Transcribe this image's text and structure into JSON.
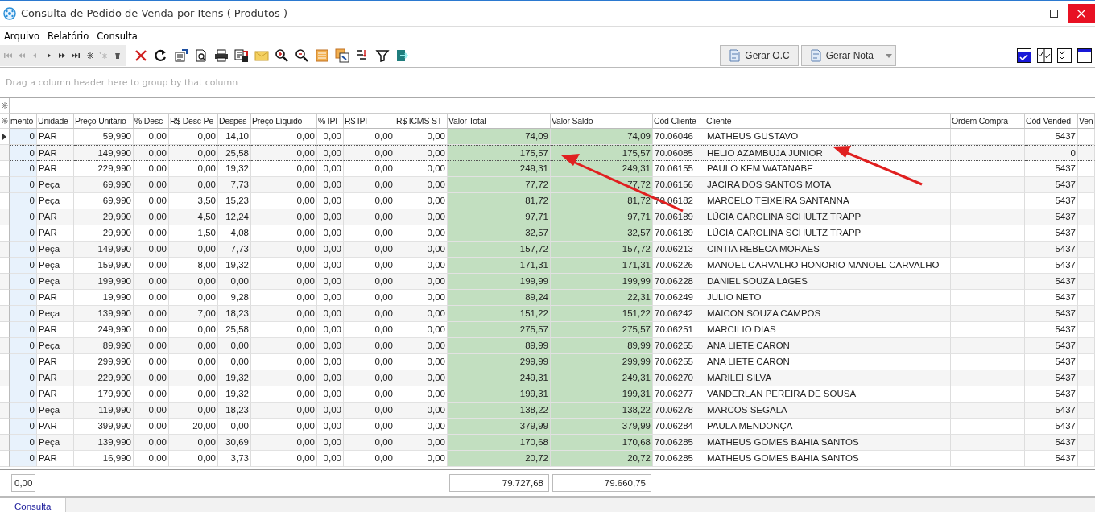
{
  "window": {
    "title": "Consulta de Pedido de Venda por Itens ( Produtos )"
  },
  "menu": [
    {
      "label": "Arquivo"
    },
    {
      "label": "Relatório"
    },
    {
      "label": "Consulta"
    }
  ],
  "toolbar": {
    "buttons": [
      {
        "label": "Gerar O.C",
        "dropdown": false
      },
      {
        "label": "Gerar Nota",
        "dropdown": true
      }
    ]
  },
  "group_panel": {
    "hint": "Drag a column header here to group by that column"
  },
  "table": {
    "columns": [
      {
        "label": "mento",
        "kind": "key",
        "summary": "0,00"
      },
      {
        "label": "Unidade",
        "kind": "text"
      },
      {
        "label": "Preço Unitário",
        "kind": "number"
      },
      {
        "label": "% Desc",
        "kind": "number"
      },
      {
        "label": "R$ Desc Pe",
        "kind": "number"
      },
      {
        "label": "Despes",
        "kind": "number"
      },
      {
        "label": "Preço Líquido",
        "kind": "number"
      },
      {
        "label": "% IPI",
        "kind": "number"
      },
      {
        "label": "R$ IPI",
        "kind": "number"
      },
      {
        "label": "R$ ICMS ST",
        "kind": "number"
      },
      {
        "label": "Valor Total",
        "kind": "total",
        "summary": "79.727,68"
      },
      {
        "label": "Valor Saldo",
        "kind": "total",
        "summary": "79.660,75"
      },
      {
        "label": "Cód Cliente",
        "kind": "text"
      },
      {
        "label": "Cliente",
        "kind": "text"
      },
      {
        "label": "Ordem Compra",
        "kind": "text"
      },
      {
        "label": "Cód Vended",
        "kind": "number"
      },
      {
        "label": "Ven",
        "kind": "text"
      }
    ],
    "rows": [
      {
        "selected": true,
        "focused": false,
        "cells": [
          "0",
          "PAR",
          "59,990",
          "0,00",
          "0,00",
          "14,10",
          "0,00",
          "0,00",
          "0,00",
          "0,00",
          "74,09",
          "74,09",
          "70.06046",
          "MATHEUS GUSTAVO",
          null,
          "5437",
          null
        ]
      },
      {
        "selected": false,
        "focused": true,
        "cells": [
          "0",
          "PAR",
          "149,990",
          "0,00",
          "0,00",
          "25,58",
          "0,00",
          "0,00",
          "0,00",
          "0,00",
          "175,57",
          "175,57",
          "70.06085",
          "HELIO AZAMBUJA JUNIOR",
          null,
          "0",
          null
        ]
      },
      {
        "selected": false,
        "focused": false,
        "cells": [
          "0",
          "PAR",
          "229,990",
          "0,00",
          "0,00",
          "19,32",
          "0,00",
          "0,00",
          "0,00",
          "0,00",
          "249,31",
          "249,31",
          "70.06155",
          "PAULO KEM WATANABE",
          null,
          "5437",
          null
        ]
      },
      {
        "selected": false,
        "focused": false,
        "cells": [
          "0",
          "Peça",
          "69,990",
          "0,00",
          "0,00",
          "7,73",
          "0,00",
          "0,00",
          "0,00",
          "0,00",
          "77,72",
          "77,72",
          "70.06156",
          "JACIRA DOS SANTOS MOTA",
          null,
          "5437",
          null
        ]
      },
      {
        "selected": false,
        "focused": false,
        "cells": [
          "0",
          "Peça",
          "69,990",
          "0,00",
          "3,50",
          "15,23",
          "0,00",
          "0,00",
          "0,00",
          "0,00",
          "81,72",
          "81,72",
          "70.06182",
          "MARCELO TEIXEIRA SANTANNA",
          null,
          "5437",
          null
        ]
      },
      {
        "selected": false,
        "focused": false,
        "cells": [
          "0",
          "PAR",
          "29,990",
          "0,00",
          "4,50",
          "12,24",
          "0,00",
          "0,00",
          "0,00",
          "0,00",
          "97,71",
          "97,71",
          "70.06189",
          "LÚCIA CAROLINA SCHULTZ TRAPP",
          null,
          "5437",
          null
        ]
      },
      {
        "selected": false,
        "focused": false,
        "cells": [
          "0",
          "PAR",
          "29,990",
          "0,00",
          "1,50",
          "4,08",
          "0,00",
          "0,00",
          "0,00",
          "0,00",
          "32,57",
          "32,57",
          "70.06189",
          "LÚCIA CAROLINA SCHULTZ TRAPP",
          null,
          "5437",
          null
        ]
      },
      {
        "selected": false,
        "focused": false,
        "cells": [
          "0",
          "Peça",
          "149,990",
          "0,00",
          "0,00",
          "7,73",
          "0,00",
          "0,00",
          "0,00",
          "0,00",
          "157,72",
          "157,72",
          "70.06213",
          "CINTIA REBECA MORAES",
          null,
          "5437",
          null
        ]
      },
      {
        "selected": false,
        "focused": false,
        "cells": [
          "0",
          "Peça",
          "159,990",
          "0,00",
          "8,00",
          "19,32",
          "0,00",
          "0,00",
          "0,00",
          "0,00",
          "171,31",
          "171,31",
          "70.06226",
          "MANOEL CARVALHO HONORIO MANOEL CARVALHO",
          null,
          "5437",
          null
        ]
      },
      {
        "selected": false,
        "focused": false,
        "cells": [
          "0",
          "Peça",
          "199,990",
          "0,00",
          "0,00",
          "0,00",
          "0,00",
          "0,00",
          "0,00",
          "0,00",
          "199,99",
          "199,99",
          "70.06228",
          "DANIEL SOUZA LAGES",
          null,
          "5437",
          null
        ]
      },
      {
        "selected": false,
        "focused": false,
        "cells": [
          "0",
          "PAR",
          "19,990",
          "0,00",
          "0,00",
          "9,28",
          "0,00",
          "0,00",
          "0,00",
          "0,00",
          "89,24",
          "22,31",
          "70.06249",
          "JULIO NETO",
          null,
          "5437",
          null
        ]
      },
      {
        "selected": false,
        "focused": false,
        "cells": [
          "0",
          "Peça",
          "139,990",
          "0,00",
          "7,00",
          "18,23",
          "0,00",
          "0,00",
          "0,00",
          "0,00",
          "151,22",
          "151,22",
          "70.06242",
          "MAICON SOUZA CAMPOS",
          null,
          "5437",
          null
        ]
      },
      {
        "selected": false,
        "focused": false,
        "cells": [
          "0",
          "PAR",
          "249,990",
          "0,00",
          "0,00",
          "25,58",
          "0,00",
          "0,00",
          "0,00",
          "0,00",
          "275,57",
          "275,57",
          "70.06251",
          "MARCILIO DIAS",
          null,
          "5437",
          null
        ]
      },
      {
        "selected": false,
        "focused": false,
        "cells": [
          "0",
          "Peça",
          "89,990",
          "0,00",
          "0,00",
          "0,00",
          "0,00",
          "0,00",
          "0,00",
          "0,00",
          "89,99",
          "89,99",
          "70.06255",
          "ANA LIETE CARON",
          null,
          "5437",
          null
        ]
      },
      {
        "selected": false,
        "focused": false,
        "cells": [
          "0",
          "PAR",
          "299,990",
          "0,00",
          "0,00",
          "0,00",
          "0,00",
          "0,00",
          "0,00",
          "0,00",
          "299,99",
          "299,99",
          "70.06255",
          "ANA LIETE CARON",
          null,
          "5437",
          null
        ]
      },
      {
        "selected": false,
        "focused": false,
        "cells": [
          "0",
          "PAR",
          "229,990",
          "0,00",
          "0,00",
          "19,32",
          "0,00",
          "0,00",
          "0,00",
          "0,00",
          "249,31",
          "249,31",
          "70.06270",
          "MARILEI SILVA",
          null,
          "5437",
          null
        ]
      },
      {
        "selected": false,
        "focused": false,
        "cells": [
          "0",
          "PAR",
          "179,990",
          "0,00",
          "0,00",
          "19,32",
          "0,00",
          "0,00",
          "0,00",
          "0,00",
          "199,31",
          "199,31",
          "70.06277",
          "VANDERLAN PEREIRA DE SOUSA",
          null,
          "5437",
          null
        ]
      },
      {
        "selected": false,
        "focused": false,
        "cells": [
          "0",
          "Peça",
          "119,990",
          "0,00",
          "0,00",
          "18,23",
          "0,00",
          "0,00",
          "0,00",
          "0,00",
          "138,22",
          "138,22",
          "70.06278",
          "MARCOS SEGALA",
          null,
          "5437",
          null
        ]
      },
      {
        "selected": false,
        "focused": false,
        "cells": [
          "0",
          "PAR",
          "399,990",
          "0,00",
          "20,00",
          "0,00",
          "0,00",
          "0,00",
          "0,00",
          "0,00",
          "379,99",
          "379,99",
          "70.06284",
          "PAULA MENDONÇA",
          null,
          "5437",
          null
        ]
      },
      {
        "selected": false,
        "focused": false,
        "cells": [
          "0",
          "Peça",
          "139,990",
          "0,00",
          "0,00",
          "30,69",
          "0,00",
          "0,00",
          "0,00",
          "0,00",
          "170,68",
          "170,68",
          "70.06285",
          "MATHEUS GOMES BAHIA SANTOS",
          null,
          "5437",
          null
        ]
      },
      {
        "selected": false,
        "focused": false,
        "cells": [
          "0",
          "PAR",
          "16,990",
          "0,00",
          "0,00",
          "3,73",
          "0,00",
          "0,00",
          "0,00",
          "0,00",
          "20,72",
          "20,72",
          "70.06285",
          "MATHEUS GOMES BAHIA SANTOS",
          null,
          "5437",
          null
        ]
      }
    ]
  },
  "tabs": [
    {
      "label": "Consulta",
      "selected": true
    }
  ]
}
